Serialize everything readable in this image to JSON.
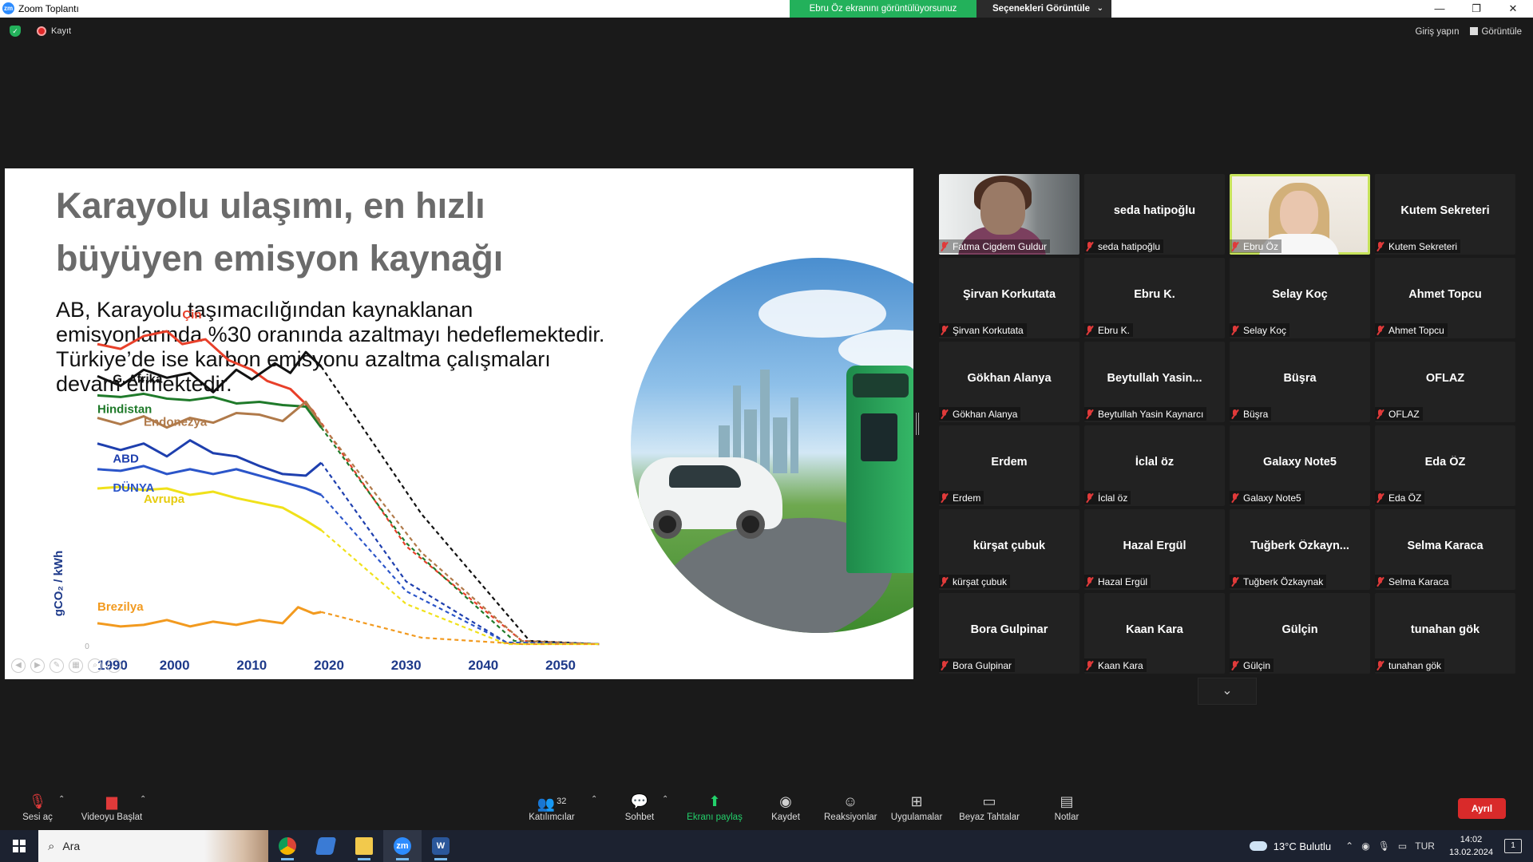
{
  "window": {
    "title": "Zoom Toplantı",
    "app_icon": "zm",
    "share_banner": "Ebru Öz ekranını görüntülüyorsunuz",
    "view_options": "Seçenekleri Görüntüle",
    "controls": {
      "minimize": "—",
      "restore": "❐",
      "close": "✕"
    }
  },
  "status": {
    "security_icon": "shield-check-icon",
    "recording_label": "Kayıt",
    "sign_in": "Giriş yapın",
    "view": "Görüntüle"
  },
  "slide": {
    "title_line1": "Karayolu ulaşımı, en hızlı",
    "title_line2": "büyüyen emisyon kaynağı",
    "body": [
      "AB, Karayolu taşımacılığından kaynaklanan",
      "emisyonlarında %30 oranında azaltmayı hedeflemektedir.",
      "Türkiye’de ise  karbon emisyonu azaltma çalışmaları",
      "devam etmektedir."
    ]
  },
  "chart_data": {
    "type": "line",
    "ylabel": "gCO₂ / kWh",
    "x_ticks": [
      "1990",
      "2000",
      "2010",
      "2020",
      "2030",
      "2040",
      "2050"
    ],
    "y_zero_label": "0",
    "xlim": [
      1990,
      2050
    ],
    "ylim": [
      0,
      1000
    ],
    "series": [
      {
        "name": "Çin",
        "color": "#e8402a",
        "x": [
          1990,
          1993,
          1996,
          1999,
          2001,
          2004,
          2007,
          2010,
          2012,
          2015,
          2018
        ],
        "y": [
          950,
          935,
          975,
          990,
          950,
          965,
          900,
          870,
          835,
          810,
          740
        ],
        "proj_x": [
          2018,
          2030,
          2045,
          2055
        ],
        "proj_y": [
          740,
          320,
          25,
          15
        ]
      },
      {
        "name": "G. Afrika",
        "color": "#111111",
        "x": [
          1990,
          1993,
          1996,
          1999,
          2002,
          2005,
          2008,
          2010,
          2013,
          2015,
          2017,
          2019
        ],
        "y": [
          850,
          820,
          870,
          845,
          860,
          800,
          870,
          840,
          890,
          860,
          925,
          880
        ],
        "proj_x": [
          2019,
          2032,
          2046,
          2055
        ],
        "proj_y": [
          880,
          420,
          25,
          15
        ]
      },
      {
        "name": "Hindistan",
        "color": "#1f7a2a",
        "x": [
          1990,
          1993,
          1996,
          1999,
          2002,
          2005,
          2008,
          2011,
          2014,
          2017,
          2019
        ],
        "y": [
          790,
          785,
          795,
          780,
          775,
          785,
          765,
          770,
          760,
          755,
          690
        ],
        "proj_x": [
          2019,
          2030,
          2044,
          2055
        ],
        "proj_y": [
          690,
          330,
          25,
          15
        ]
      },
      {
        "name": "Endonezya",
        "color": "#b07a4a",
        "x": [
          1990,
          1993,
          1996,
          1999,
          2002,
          2005,
          2008,
          2011,
          2014,
          2017,
          2019
        ],
        "y": [
          720,
          700,
          725,
          690,
          720,
          705,
          735,
          730,
          710,
          770,
          700
        ],
        "proj_x": [
          2019,
          2032,
          2045,
          2055
        ],
        "proj_y": [
          700,
          300,
          25,
          15
        ]
      },
      {
        "name": "ABD",
        "color": "#1e3fae",
        "x": [
          1990,
          1993,
          1996,
          1999,
          2002,
          2005,
          2008,
          2011,
          2014,
          2017,
          2019
        ],
        "y": [
          640,
          620,
          640,
          600,
          650,
          610,
          600,
          570,
          545,
          540,
          580
        ],
        "proj_x": [
          2019,
          2030,
          2043,
          2055
        ],
        "proj_y": [
          580,
          210,
          20,
          15
        ]
      },
      {
        "name": "DÜNYA",
        "color": "#2b55c9",
        "x": [
          1990,
          1993,
          1996,
          1999,
          2002,
          2005,
          2008,
          2011,
          2014,
          2017,
          2019
        ],
        "y": [
          560,
          555,
          570,
          545,
          560,
          545,
          560,
          540,
          520,
          500,
          480
        ],
        "proj_x": [
          2019,
          2030,
          2043,
          2055
        ],
        "proj_y": [
          480,
          180,
          20,
          15
        ]
      },
      {
        "name": "Avrupa",
        "color": "#f0e11a",
        "x": [
          1990,
          1993,
          1996,
          1999,
          2002,
          2005,
          2008,
          2011,
          2014,
          2017,
          2019
        ],
        "y": [
          500,
          505,
          495,
          500,
          480,
          490,
          470,
          455,
          440,
          400,
          370
        ],
        "proj_x": [
          2019,
          2030,
          2043,
          2055
        ],
        "proj_y": [
          370,
          140,
          15,
          15
        ]
      },
      {
        "name": "Brezilya",
        "color": "#f29a1f",
        "x": [
          1990,
          1993,
          1996,
          1999,
          2002,
          2005,
          2008,
          2011,
          2014,
          2016,
          2018,
          2019
        ],
        "y": [
          80,
          70,
          75,
          90,
          70,
          85,
          75,
          90,
          80,
          130,
          110,
          115
        ],
        "proj_x": [
          2019,
          2032,
          2045,
          2055
        ],
        "proj_y": [
          115,
          35,
          15,
          15
        ]
      }
    ]
  },
  "gallery": {
    "tiles": [
      {
        "big": "",
        "small": "Fatma Cigdem Guldur",
        "video": "fatma"
      },
      {
        "big": "seda hatipoğlu",
        "small": "seda hatipoğlu"
      },
      {
        "big": "",
        "small": "Ebru Öz",
        "video": "ebru",
        "active": true
      },
      {
        "big": "Kutem Sekreteri",
        "small": "Kutem Sekreteri"
      },
      {
        "big": "Şirvan Korkutata",
        "small": "Şirvan Korkutata"
      },
      {
        "big": "Ebru K.",
        "small": "Ebru K."
      },
      {
        "big": "Selay Koç",
        "small": "Selay Koç"
      },
      {
        "big": "Ahmet Topcu",
        "small": "Ahmet Topcu"
      },
      {
        "big": "Gökhan Alanya",
        "small": "Gökhan Alanya"
      },
      {
        "big": "Beytullah  Yasin...",
        "small": "Beytullah Yasin Kaynarcı"
      },
      {
        "big": "Büşra",
        "small": "Büşra"
      },
      {
        "big": "OFLAZ",
        "small": "OFLAZ"
      },
      {
        "big": "Erdem",
        "small": "Erdem"
      },
      {
        "big": "İclal öz",
        "small": "İclal öz"
      },
      {
        "big": "Galaxy Note5",
        "small": "Galaxy Note5"
      },
      {
        "big": "Eda ÖZ",
        "small": "Eda ÖZ"
      },
      {
        "big": "kürşat çubuk",
        "small": "kürşat çubuk"
      },
      {
        "big": "Hazal Ergül",
        "small": "Hazal Ergül"
      },
      {
        "big": "Tuğberk  Özkayn...",
        "small": "Tuğberk Özkaynak"
      },
      {
        "big": "Selma Karaca",
        "small": "Selma Karaca"
      },
      {
        "big": "Bora Gulpinar",
        "small": "Bora Gulpinar"
      },
      {
        "big": "Kaan Kara",
        "small": "Kaan Kara"
      },
      {
        "big": "Gülçin",
        "small": "Gülçin"
      },
      {
        "big": "tunahan gök",
        "small": "tunahan gök"
      }
    ]
  },
  "toolbar": {
    "unmute": "Sesi aç",
    "start_video": "Videoyu Başlat",
    "participants": "Katılımcılar",
    "participant_count": "32",
    "chat": "Sohbet",
    "share_screen": "Ekranı paylaş",
    "record": "Kaydet",
    "reactions": "Reaksiyonlar",
    "apps": "Uygulamalar",
    "whiteboards": "Beyaz Tahtalar",
    "notes": "Notlar",
    "leave": "Ayrıl"
  },
  "taskbar": {
    "search_placeholder": "Ara",
    "weather": "13°C  Bulutlu",
    "lang": "TUR",
    "time": "14:02",
    "date": "13.02.2024",
    "notification_count": "1"
  },
  "colors": {
    "zoom_green": "#23b15b",
    "leave_red": "#d92a2a",
    "active_speaker": "#c7e35b"
  }
}
